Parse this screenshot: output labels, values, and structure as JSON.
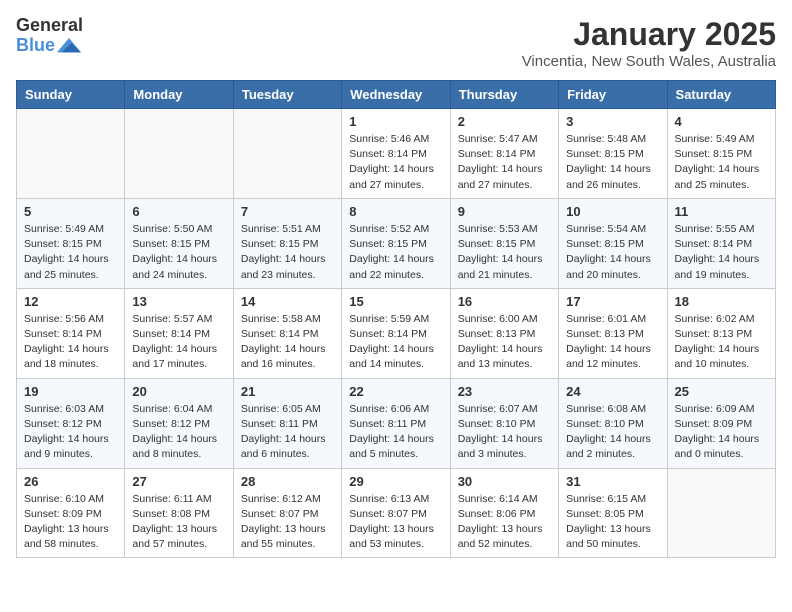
{
  "header": {
    "logo_general": "General",
    "logo_blue": "Blue",
    "month_year": "January 2025",
    "location": "Vincentia, New South Wales, Australia"
  },
  "weekdays": [
    "Sunday",
    "Monday",
    "Tuesday",
    "Wednesday",
    "Thursday",
    "Friday",
    "Saturday"
  ],
  "weeks": [
    [
      {
        "day": "",
        "info": ""
      },
      {
        "day": "",
        "info": ""
      },
      {
        "day": "",
        "info": ""
      },
      {
        "day": "1",
        "info": "Sunrise: 5:46 AM\nSunset: 8:14 PM\nDaylight: 14 hours\nand 27 minutes."
      },
      {
        "day": "2",
        "info": "Sunrise: 5:47 AM\nSunset: 8:14 PM\nDaylight: 14 hours\nand 27 minutes."
      },
      {
        "day": "3",
        "info": "Sunrise: 5:48 AM\nSunset: 8:15 PM\nDaylight: 14 hours\nand 26 minutes."
      },
      {
        "day": "4",
        "info": "Sunrise: 5:49 AM\nSunset: 8:15 PM\nDaylight: 14 hours\nand 25 minutes."
      }
    ],
    [
      {
        "day": "5",
        "info": "Sunrise: 5:49 AM\nSunset: 8:15 PM\nDaylight: 14 hours\nand 25 minutes."
      },
      {
        "day": "6",
        "info": "Sunrise: 5:50 AM\nSunset: 8:15 PM\nDaylight: 14 hours\nand 24 minutes."
      },
      {
        "day": "7",
        "info": "Sunrise: 5:51 AM\nSunset: 8:15 PM\nDaylight: 14 hours\nand 23 minutes."
      },
      {
        "day": "8",
        "info": "Sunrise: 5:52 AM\nSunset: 8:15 PM\nDaylight: 14 hours\nand 22 minutes."
      },
      {
        "day": "9",
        "info": "Sunrise: 5:53 AM\nSunset: 8:15 PM\nDaylight: 14 hours\nand 21 minutes."
      },
      {
        "day": "10",
        "info": "Sunrise: 5:54 AM\nSunset: 8:15 PM\nDaylight: 14 hours\nand 20 minutes."
      },
      {
        "day": "11",
        "info": "Sunrise: 5:55 AM\nSunset: 8:14 PM\nDaylight: 14 hours\nand 19 minutes."
      }
    ],
    [
      {
        "day": "12",
        "info": "Sunrise: 5:56 AM\nSunset: 8:14 PM\nDaylight: 14 hours\nand 18 minutes."
      },
      {
        "day": "13",
        "info": "Sunrise: 5:57 AM\nSunset: 8:14 PM\nDaylight: 14 hours\nand 17 minutes."
      },
      {
        "day": "14",
        "info": "Sunrise: 5:58 AM\nSunset: 8:14 PM\nDaylight: 14 hours\nand 16 minutes."
      },
      {
        "day": "15",
        "info": "Sunrise: 5:59 AM\nSunset: 8:14 PM\nDaylight: 14 hours\nand 14 minutes."
      },
      {
        "day": "16",
        "info": "Sunrise: 6:00 AM\nSunset: 8:13 PM\nDaylight: 14 hours\nand 13 minutes."
      },
      {
        "day": "17",
        "info": "Sunrise: 6:01 AM\nSunset: 8:13 PM\nDaylight: 14 hours\nand 12 minutes."
      },
      {
        "day": "18",
        "info": "Sunrise: 6:02 AM\nSunset: 8:13 PM\nDaylight: 14 hours\nand 10 minutes."
      }
    ],
    [
      {
        "day": "19",
        "info": "Sunrise: 6:03 AM\nSunset: 8:12 PM\nDaylight: 14 hours\nand 9 minutes."
      },
      {
        "day": "20",
        "info": "Sunrise: 6:04 AM\nSunset: 8:12 PM\nDaylight: 14 hours\nand 8 minutes."
      },
      {
        "day": "21",
        "info": "Sunrise: 6:05 AM\nSunset: 8:11 PM\nDaylight: 14 hours\nand 6 minutes."
      },
      {
        "day": "22",
        "info": "Sunrise: 6:06 AM\nSunset: 8:11 PM\nDaylight: 14 hours\nand 5 minutes."
      },
      {
        "day": "23",
        "info": "Sunrise: 6:07 AM\nSunset: 8:10 PM\nDaylight: 14 hours\nand 3 minutes."
      },
      {
        "day": "24",
        "info": "Sunrise: 6:08 AM\nSunset: 8:10 PM\nDaylight: 14 hours\nand 2 minutes."
      },
      {
        "day": "25",
        "info": "Sunrise: 6:09 AM\nSunset: 8:09 PM\nDaylight: 14 hours\nand 0 minutes."
      }
    ],
    [
      {
        "day": "26",
        "info": "Sunrise: 6:10 AM\nSunset: 8:09 PM\nDaylight: 13 hours\nand 58 minutes."
      },
      {
        "day": "27",
        "info": "Sunrise: 6:11 AM\nSunset: 8:08 PM\nDaylight: 13 hours\nand 57 minutes."
      },
      {
        "day": "28",
        "info": "Sunrise: 6:12 AM\nSunset: 8:07 PM\nDaylight: 13 hours\nand 55 minutes."
      },
      {
        "day": "29",
        "info": "Sunrise: 6:13 AM\nSunset: 8:07 PM\nDaylight: 13 hours\nand 53 minutes."
      },
      {
        "day": "30",
        "info": "Sunrise: 6:14 AM\nSunset: 8:06 PM\nDaylight: 13 hours\nand 52 minutes."
      },
      {
        "day": "31",
        "info": "Sunrise: 6:15 AM\nSunset: 8:05 PM\nDaylight: 13 hours\nand 50 minutes."
      },
      {
        "day": "",
        "info": ""
      }
    ]
  ]
}
